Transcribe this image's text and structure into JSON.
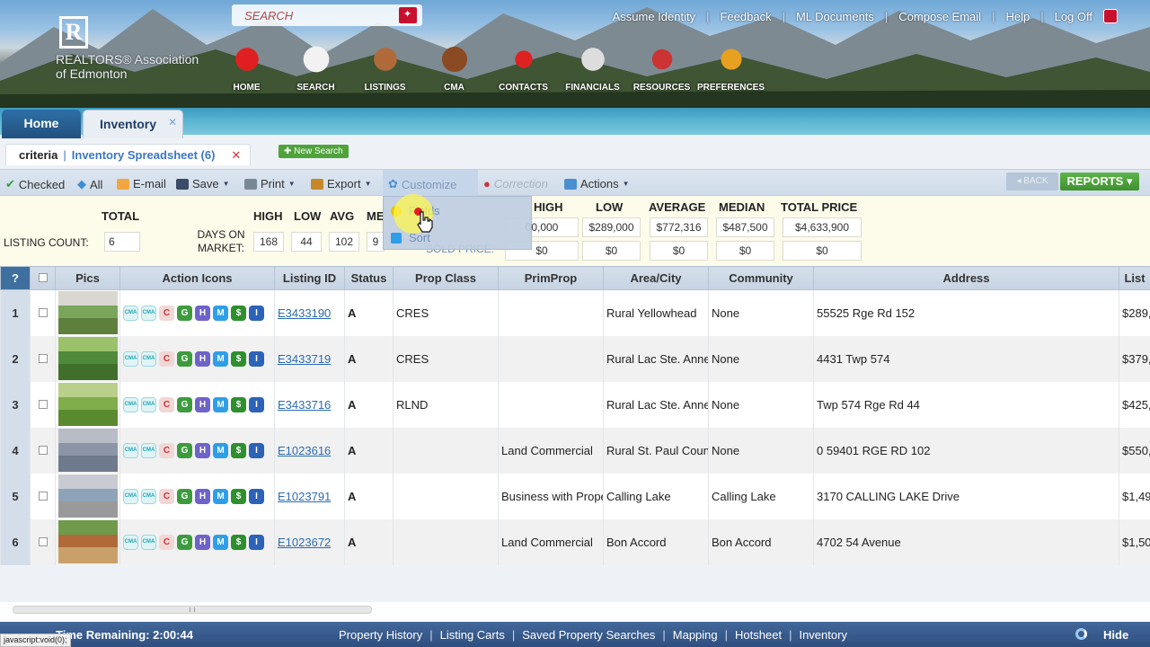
{
  "header": {
    "search_placeholder": "SEARCH",
    "logo_text": "REALTORS® Association of Edmonton",
    "top_links": [
      "Assume Identity",
      "Feedback",
      "ML Documents",
      "Compose Email",
      "Help",
      "Log Off"
    ],
    "nav": [
      "HOME",
      "SEARCH",
      "LISTINGS",
      "CMA",
      "CONTACTS",
      "FINANCIALS",
      "RESOURCES",
      "PREFERENCES"
    ]
  },
  "tabs": {
    "home": "Home",
    "inventory": "Inventory",
    "close": "✕"
  },
  "criteria": {
    "label": "criteria",
    "sep": "|",
    "name": "Inventory Spreadsheet (6)",
    "close": "✕",
    "new_search": "New Search"
  },
  "toolbar": {
    "checked": "Checked",
    "all": "All",
    "email": "E-mail",
    "save": "Save",
    "print": "Print",
    "export": "Export",
    "customize": "Customize",
    "correction": "Correction",
    "actions": "Actions",
    "back": "BACK",
    "reports": "REPORTS"
  },
  "dropdown": {
    "fields": "Fields",
    "sort": "Sort"
  },
  "stats": {
    "total_label": "TOTAL",
    "listing_count_label": "LISTING COUNT:",
    "listing_count": "6",
    "days_on_market_label": "DAYS ON MARKET:",
    "dom_headers": [
      "HIGH",
      "LOW",
      "AVG",
      "ME"
    ],
    "dom_values": [
      "168",
      "44",
      "102",
      "9"
    ],
    "price_headers": [
      "HIGH",
      "LOW",
      "AVERAGE",
      "MEDIAN",
      "TOTAL PRICE"
    ],
    "list_price_values": [
      "00,000",
      "$289,000",
      "$772,316",
      "$487,500",
      "$4,633,900"
    ],
    "sold_price_label": "SOLD PRICE:",
    "sold_price_values": [
      "$0",
      "$0",
      "$0",
      "$0",
      "$0"
    ]
  },
  "table": {
    "headers": [
      "?",
      "",
      "Pics",
      "Action Icons",
      "Listing ID",
      "Status",
      "Prop Class",
      "PrimProp",
      "Area/City",
      "Community",
      "Address",
      "List"
    ],
    "action_icons": [
      "CMA",
      "CMA",
      "C",
      "G",
      "H",
      "M",
      "$",
      "I"
    ],
    "rows": [
      {
        "n": "1",
        "id": "E3433190",
        "status": "A",
        "prop_class": "CRES",
        "primprop": "",
        "area": "Rural Yellowhead",
        "community": "None",
        "address": "55525 Rge Rd 152",
        "list": "$289,"
      },
      {
        "n": "2",
        "id": "E3433719",
        "status": "A",
        "prop_class": "CRES",
        "primprop": "",
        "area": "Rural Lac Ste. Anne",
        "community": "None",
        "address": "4431 Twp 574",
        "list": "$379,"
      },
      {
        "n": "3",
        "id": "E3433716",
        "status": "A",
        "prop_class": "RLND",
        "primprop": "",
        "area": "Rural Lac Ste. Anne",
        "community": "None",
        "address": "Twp 574 Rge Rd 44",
        "list": "$425,"
      },
      {
        "n": "4",
        "id": "E1023616",
        "status": "A",
        "prop_class": "",
        "primprop": "Land Commercial",
        "area": "Rural St. Paul County",
        "community": "None",
        "address": "0 59401 RGE RD 102",
        "list": "$550,"
      },
      {
        "n": "5",
        "id": "E1023791",
        "status": "A",
        "prop_class": "",
        "primprop": "Business with Property",
        "area": "Calling Lake",
        "community": "Calling Lake",
        "address": "3170 CALLING LAKE Drive",
        "list": "$1,49"
      },
      {
        "n": "6",
        "id": "E1023672",
        "status": "A",
        "prop_class": "",
        "primprop": "Land Commercial",
        "area": "Bon Accord",
        "community": "Bon Accord",
        "address": "4702 54 Avenue",
        "list": "$1,50"
      }
    ]
  },
  "footer": {
    "time_remaining": "Time Remaining: 2:00:44",
    "links": [
      "Property History",
      "Listing Carts",
      "Saved Property Searches",
      "Mapping",
      "Hotsheet",
      "Inventory"
    ],
    "hide": "Hide",
    "status_text": "javascript:void(0);"
  },
  "colors": {
    "accent_blue": "#2e6fa6",
    "reports_green": "#3e912e",
    "highlight_yellow": "#fff650",
    "header_blue": "#43679a"
  }
}
